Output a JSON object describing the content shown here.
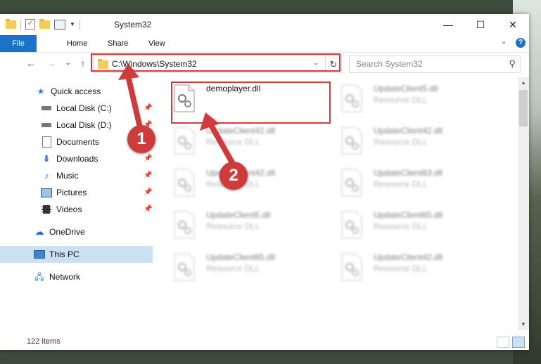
{
  "window": {
    "title": "System32",
    "minimize": "—",
    "maximize": "☐",
    "close": "✕"
  },
  "ribbon": {
    "file": "File",
    "home": "Home",
    "share": "Share",
    "view": "View"
  },
  "nav": {
    "back": "←",
    "forward": "→",
    "recent": "⌄",
    "up": "↑"
  },
  "address": {
    "path": "C:\\Windows\\System32",
    "dropdown": "⌄",
    "refresh": "↻"
  },
  "search": {
    "placeholder": "Search System32"
  },
  "sidebar": {
    "quick_access": "Quick access",
    "items": [
      "Local Disk (C:)",
      "Local Disk (D:)",
      "Documents",
      "Downloads",
      "Music",
      "Pictures",
      "Videos"
    ],
    "onedrive": "OneDrive",
    "this_pc": "This PC",
    "network": "Network"
  },
  "files": [
    {
      "name": "demoplayer.dll",
      "type": ""
    },
    {
      "name": "UpdateClient5.dll",
      "type": "Resource DLL"
    },
    {
      "name": "UpdateClient42.dll",
      "type": "Resource DLL"
    },
    {
      "name": "UpdateClient42.dll",
      "type": "Resource DLL"
    },
    {
      "name": "UpdateClient42.dll",
      "type": "Resource DLL"
    },
    {
      "name": "UpdateClient63.dll",
      "type": "Resource DLL"
    },
    {
      "name": "UpdateClient5.dll",
      "type": "Resource DLL"
    },
    {
      "name": "UpdateClient65.dll",
      "type": "Resource DLL"
    },
    {
      "name": "UpdateClient65.dll",
      "type": "Resource DLL"
    },
    {
      "name": "UpdateClient42.dll",
      "type": "Resource DLL"
    }
  ],
  "status": {
    "count": "122 items"
  },
  "callouts": {
    "one": "1",
    "two": "2"
  },
  "colors": {
    "accent": "#1a73c9",
    "highlight": "#d23b3b",
    "selection": "#cce0f4"
  }
}
